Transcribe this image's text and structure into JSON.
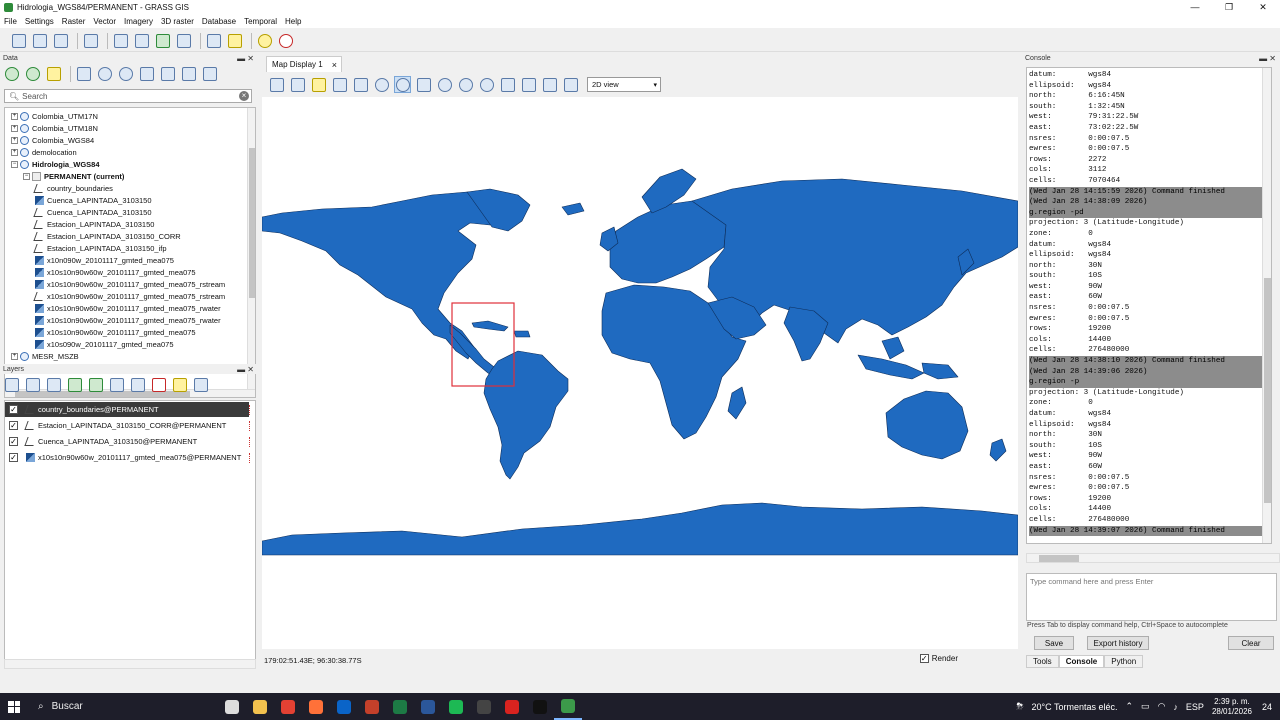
{
  "window": {
    "title": "Hidrologia_WGS84/PERMANENT - GRASS GIS",
    "minimize": "—",
    "maximize": "❐",
    "close": "✕"
  },
  "menu": [
    "File",
    "Settings",
    "Raster",
    "Vector",
    "Imagery",
    "3D raster",
    "Database",
    "Temporal",
    "Help"
  ],
  "data_panel": {
    "title": "Data",
    "search_placeholder": "Search",
    "tree": [
      {
        "label": "Colombia_UTM17N",
        "indent": 1,
        "kind": "globe",
        "exp": "+"
      },
      {
        "label": "Colombia_UTM18N",
        "indent": 1,
        "kind": "globe",
        "exp": "+"
      },
      {
        "label": "Colombia_WGS84",
        "indent": 1,
        "kind": "globe",
        "exp": "+"
      },
      {
        "label": "demolocation",
        "indent": 1,
        "kind": "globe",
        "exp": "+"
      },
      {
        "label": "Hidrologia_WGS84",
        "indent": 1,
        "kind": "globe",
        "exp": "−",
        "bold": true
      },
      {
        "label": "PERMANENT  (current)",
        "indent": 2,
        "kind": "mapset",
        "exp": "−",
        "bold": true
      },
      {
        "label": "country_boundaries",
        "indent": 3,
        "kind": "vect"
      },
      {
        "label": "Cuenca_LAPINTADA_3103150",
        "indent": 3,
        "kind": "rast"
      },
      {
        "label": "Cuenca_LAPINTADA_3103150",
        "indent": 3,
        "kind": "vect"
      },
      {
        "label": "Estacion_LAPINTADA_3103150",
        "indent": 3,
        "kind": "vect"
      },
      {
        "label": "Estacion_LAPINTADA_3103150_CORR",
        "indent": 3,
        "kind": "vect"
      },
      {
        "label": "Estacion_LAPINTADA_3103150_ifp",
        "indent": 3,
        "kind": "vect"
      },
      {
        "label": "x10n090w_20101117_gmted_mea075",
        "indent": 3,
        "kind": "rast"
      },
      {
        "label": "x10s10n90w60w_20101117_gmted_mea075",
        "indent": 3,
        "kind": "rast"
      },
      {
        "label": "x10s10n90w60w_20101117_gmted_mea075_rstream",
        "indent": 3,
        "kind": "rast"
      },
      {
        "label": "x10s10n90w60w_20101117_gmted_mea075_rstream",
        "indent": 3,
        "kind": "vect"
      },
      {
        "label": "x10s10n90w60w_20101117_gmted_mea075_rwater",
        "indent": 3,
        "kind": "rast"
      },
      {
        "label": "x10s10n90w60w_20101117_gmted_mea075_rwater",
        "indent": 3,
        "kind": "rast"
      },
      {
        "label": "x10s10n90w60w_20101117_gmted_mea075",
        "indent": 3,
        "kind": "rast"
      },
      {
        "label": "x10s090w_20101117_gmted_mea075",
        "indent": 3,
        "kind": "rast"
      },
      {
        "label": "MESR_MSZB",
        "indent": 1,
        "kind": "globe",
        "exp": "+"
      }
    ]
  },
  "layers_panel": {
    "title": "Layers",
    "layers": [
      {
        "label": "country_boundaries@PERMANENT",
        "kind": "vect",
        "selected": true
      },
      {
        "label": "Estacion_LAPINTADA_3103150_CORR@PERMANENT",
        "kind": "vect"
      },
      {
        "label": "Cuenca_LAPINTADA_3103150@PERMANENT",
        "kind": "vect"
      },
      {
        "label": "x10s10n90w60w_20101117_gmted_mea075@PERMANENT",
        "kind": "rast"
      }
    ]
  },
  "map": {
    "tab_label": "Map Display 1",
    "view_mode": "2D view",
    "coords": "179:02:51.43E; 96:30:38.77S",
    "render_label": "Render",
    "land_color": "#1f6ac0",
    "region_color": "#e0303a"
  },
  "console_panel": {
    "title": "Console",
    "lines": [
      {
        "t": "datum:       wgs84"
      },
      {
        "t": "ellipsoid:   wgs84"
      },
      {
        "t": "north:       6:16:45N"
      },
      {
        "t": "south:       1:32:45N"
      },
      {
        "t": "west:        79:31:22.5W"
      },
      {
        "t": "east:        73:02:22.5W"
      },
      {
        "t": "nsres:       0:00:07.5"
      },
      {
        "t": "ewres:       0:00:07.5"
      },
      {
        "t": "rows:        2272"
      },
      {
        "t": "cols:        3112"
      },
      {
        "t": "cells:       7070464"
      },
      {
        "t": "(Wed Jan 28 14:15:59 2026) Command finished",
        "hl": true
      },
      {
        "t": "(Wed Jan 28 14:38:09 2026)",
        "hl": true
      },
      {
        "t": "g.region -pd",
        "hl": true
      },
      {
        "t": "projection: 3 (Latitude-Longitude)"
      },
      {
        "t": "zone:        0"
      },
      {
        "t": "datum:       wgs84"
      },
      {
        "t": "ellipsoid:   wgs84"
      },
      {
        "t": "north:       30N"
      },
      {
        "t": "south:       10S"
      },
      {
        "t": "west:        90W"
      },
      {
        "t": "east:        60W"
      },
      {
        "t": "nsres:       0:00:07.5"
      },
      {
        "t": "ewres:       0:00:07.5"
      },
      {
        "t": "rows:        19200"
      },
      {
        "t": "cols:        14400"
      },
      {
        "t": "cells:       276480000"
      },
      {
        "t": "(Wed Jan 28 14:38:10 2026) Command finished",
        "hl": true
      },
      {
        "t": "(Wed Jan 28 14:39:06 2026)",
        "hl": true
      },
      {
        "t": "g.region -p",
        "hl": true
      },
      {
        "t": "projection: 3 (Latitude-Longitude)"
      },
      {
        "t": "zone:        0"
      },
      {
        "t": "datum:       wgs84"
      },
      {
        "t": "ellipsoid:   wgs84"
      },
      {
        "t": "north:       30N"
      },
      {
        "t": "south:       10S"
      },
      {
        "t": "west:        90W"
      },
      {
        "t": "east:        60W"
      },
      {
        "t": "nsres:       0:00:07.5"
      },
      {
        "t": "ewres:       0:00:07.5"
      },
      {
        "t": "rows:        19200"
      },
      {
        "t": "cols:        14400"
      },
      {
        "t": "cells:       276480000"
      },
      {
        "t": "(Wed Jan 28 14:39:07 2026) Command finished",
        "hl": true
      }
    ],
    "input_placeholder": "Type command here and press Enter",
    "hint": "Press Tab to display command help, Ctrl+Space to autocomplete",
    "save_label": "Save",
    "export_label": "Export history",
    "clear_label": "Clear",
    "tabs": [
      "Tools",
      "Console",
      "Python"
    ],
    "active_tab": "Console"
  },
  "taskbar": {
    "search_label": "Buscar",
    "weather": "20°C  Tormentas eléc.",
    "lang": "ESP",
    "time": "2:39 p. m.",
    "date": "28/01/2026",
    "notif": "24",
    "apps": [
      {
        "name": "task-view",
        "color": "#dddddd"
      },
      {
        "name": "file-explorer",
        "color": "#f2c14e"
      },
      {
        "name": "chrome",
        "color": "#e34133"
      },
      {
        "name": "firefox",
        "color": "#ff7139"
      },
      {
        "name": "outlook",
        "color": "#0a64c8"
      },
      {
        "name": "powerpoint",
        "color": "#c4402a"
      },
      {
        "name": "excel",
        "color": "#1d7a45"
      },
      {
        "name": "word",
        "color": "#2b579a"
      },
      {
        "name": "spotify",
        "color": "#1db954"
      },
      {
        "name": "obs",
        "color": "#444444"
      },
      {
        "name": "acrobat",
        "color": "#d9231f"
      },
      {
        "name": "terminal",
        "color": "#111111"
      },
      {
        "name": "grass-gis",
        "color": "#3c9a4a",
        "active": true
      }
    ]
  }
}
